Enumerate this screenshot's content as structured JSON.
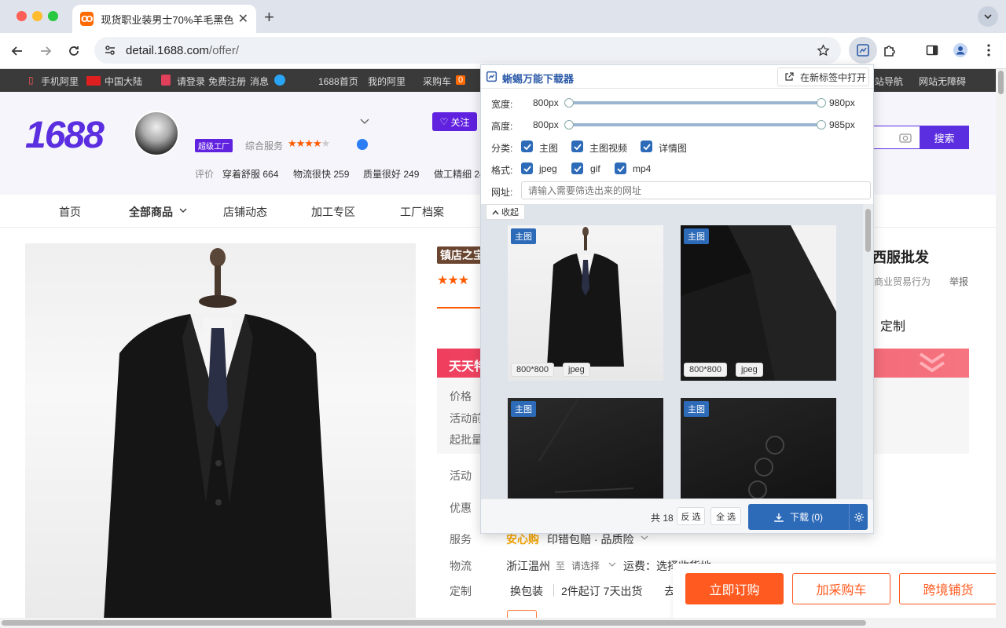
{
  "browser": {
    "tab_title": "现货职业装男士70%羊毛黑色高",
    "url_host": "detail.1688.com",
    "url_path": "/offer/"
  },
  "topbar": {
    "items": [
      "手机阿里",
      "中国大陆",
      "请登录",
      "免费注册",
      "消息",
      "1688首页",
      "我的阿里",
      "采购车",
      "0",
      "站导航",
      "网站无障碍"
    ]
  },
  "header": {
    "logo": "1688",
    "badge": "超级工厂",
    "service_label": "综合服务",
    "follow": "关注",
    "search": "搜索",
    "ratings": [
      {
        "label": "评价",
        "text": ""
      },
      {
        "label": "穿着舒服",
        "count": "664"
      },
      {
        "label": "物流很快",
        "count": "259"
      },
      {
        "label": "质量很好",
        "count": "249"
      },
      {
        "label": "做工精细",
        "count": "24"
      }
    ]
  },
  "nav": {
    "items": [
      "首页",
      "全部商品",
      "店铺动态",
      "加工专区",
      "工厂档案"
    ]
  },
  "product": {
    "store_badge": "镇店之宝",
    "title_tail": "西服批发",
    "report_prefix": "商业贸易行为",
    "report": "举报",
    "custom_tail": "定制",
    "promo": "天天特",
    "price_labels": [
      "价格",
      "活动前",
      "起批量"
    ],
    "rows": {
      "activity": "活动",
      "discount": "优惠",
      "service_label": "服务",
      "service_logo": "安心购",
      "service_val": "印错包赔 · 品质险",
      "logistics_label": "物流",
      "logistics_from": "浙江温州",
      "logistics_to": "至",
      "logistics_select": "请选择",
      "logistics_fee": "运费：选择收货地",
      "custom_label": "定制",
      "custom_pack": "换包装",
      "custom_detail": "2件起订 7天出货",
      "custom_more": "去"
    },
    "buttons": {
      "buy": "立即订购",
      "cart": "加采购车",
      "cross": "跨境铺货"
    }
  },
  "extension": {
    "title": "蜥蜴万能下载器",
    "open_new_tab": "在新标签中打开",
    "width_label": "宽度:",
    "height_label": "高度:",
    "width_min": "800px",
    "width_max": "980px",
    "height_min": "800px",
    "height_max": "985px",
    "category_label": "分类:",
    "categories": [
      "主图",
      "主图视频",
      "详情图"
    ],
    "format_label": "格式:",
    "formats": [
      "jpeg",
      "gif",
      "mp4"
    ],
    "url_label": "网址:",
    "url_placeholder": "请输入需要筛选出来的网址",
    "collapse": "收起",
    "images": [
      {
        "tag": "主图",
        "size": "800*800",
        "format": "jpeg"
      },
      {
        "tag": "主图",
        "size": "800*800",
        "format": "jpeg"
      },
      {
        "tag": "主图",
        "size": "",
        "format": ""
      },
      {
        "tag": "主图",
        "size": "",
        "format": ""
      }
    ],
    "total": "共 18",
    "invert": "反 选",
    "select_all": "全 选",
    "download": "下载 (0)"
  }
}
